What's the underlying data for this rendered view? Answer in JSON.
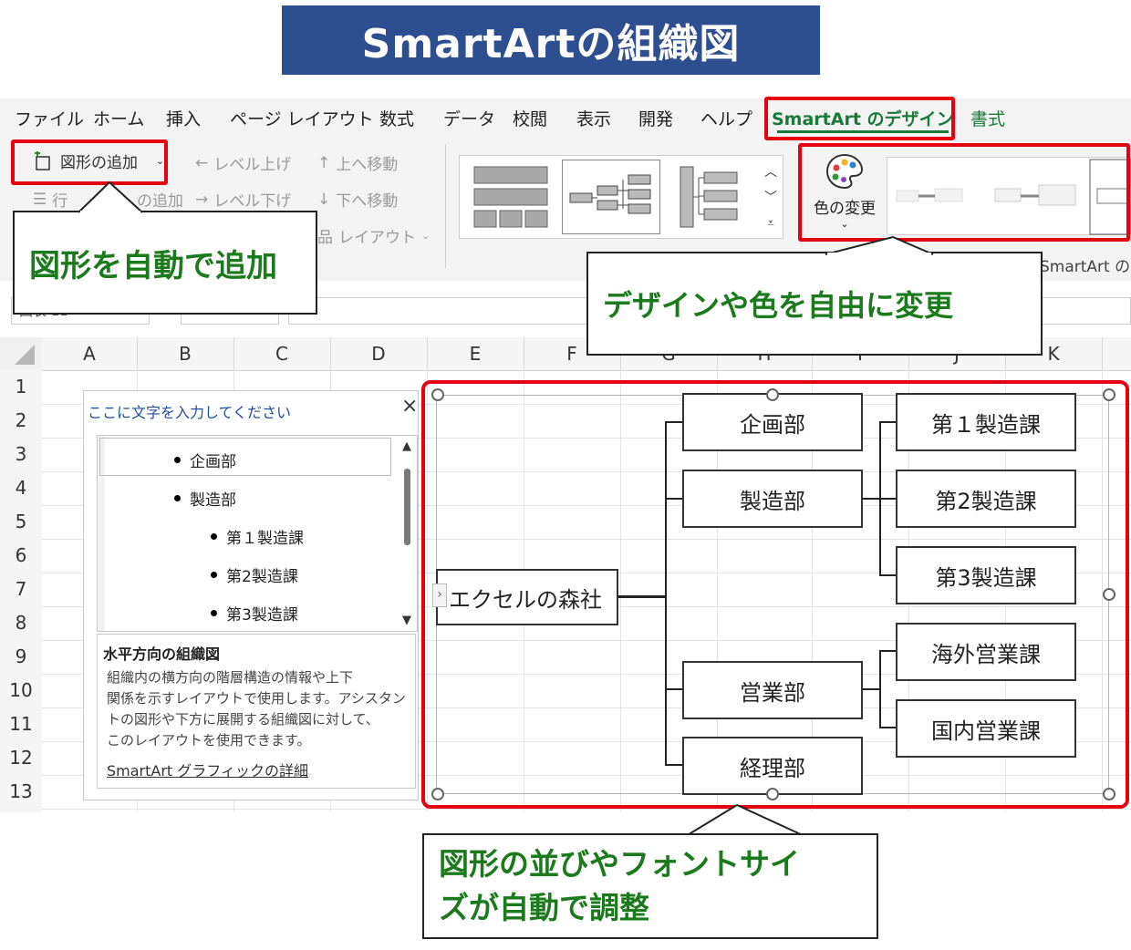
{
  "banner_title": "SmartArtの組織図",
  "tabs": [
    "ファイル",
    "ホーム",
    "挿入",
    "ページ レイアウト",
    "数式",
    "データ",
    "校閲",
    "表示",
    "開発",
    "ヘルプ",
    "SmartArt のデザイン",
    "書式"
  ],
  "ribbon": {
    "add_shape": "図形の追加",
    "add_bullet_partial_left": "行",
    "add_bullet_partial_right": "の追加",
    "promote": "レベル上げ",
    "demote": "レベル下げ",
    "move_up": "上へ移動",
    "move_down": "下へ移動",
    "layout": "レイアウト",
    "change_colors": "色の変更",
    "styles_group_partial": "SmartArt の",
    "name_box_partial": "図表 11"
  },
  "callouts": {
    "add_auto": "図形を自動で追加",
    "design_change": "デザインや色を自由に変更",
    "auto_adjust_line1": "図形の並びやフォントサイ",
    "auto_adjust_line2": "ズが自動で調整"
  },
  "columns": [
    "A",
    "B",
    "C",
    "D",
    "E",
    "F",
    "G",
    "H",
    "I",
    "J",
    "K"
  ],
  "rows": [
    "1",
    "2",
    "3",
    "4",
    "5",
    "6",
    "7",
    "8",
    "9",
    "10",
    "11",
    "12",
    "13"
  ],
  "text_pane": {
    "title": "ここに文字を入力してください",
    "close": "×",
    "items": [
      "企画部",
      "製造部",
      "第１製造課",
      "第2製造課",
      "第3製造課"
    ],
    "desc_title": "水平方向の組織図",
    "desc_line1": "組織内の横方向の階層構造の情報や上下",
    "desc_line2": "関係を示すレイアウトで使用します。アシスタン",
    "desc_line3": "トの図形や下方に展開する組織図に対して、",
    "desc_line4": "このレイアウトを使用できます。",
    "link": "SmartArt グラフィックの詳細"
  },
  "org": {
    "root": "エクセルの森社",
    "depts": [
      "企画部",
      "製造部",
      "営業部",
      "経理部"
    ],
    "sections": [
      "第１製造課",
      "第2製造課",
      "第3製造課",
      "海外営業課",
      "国内営業課"
    ]
  },
  "colors": {
    "accent_red": "#e50012",
    "banner_blue": "#2e4f8f",
    "callout_green": "#1b7a1b"
  }
}
